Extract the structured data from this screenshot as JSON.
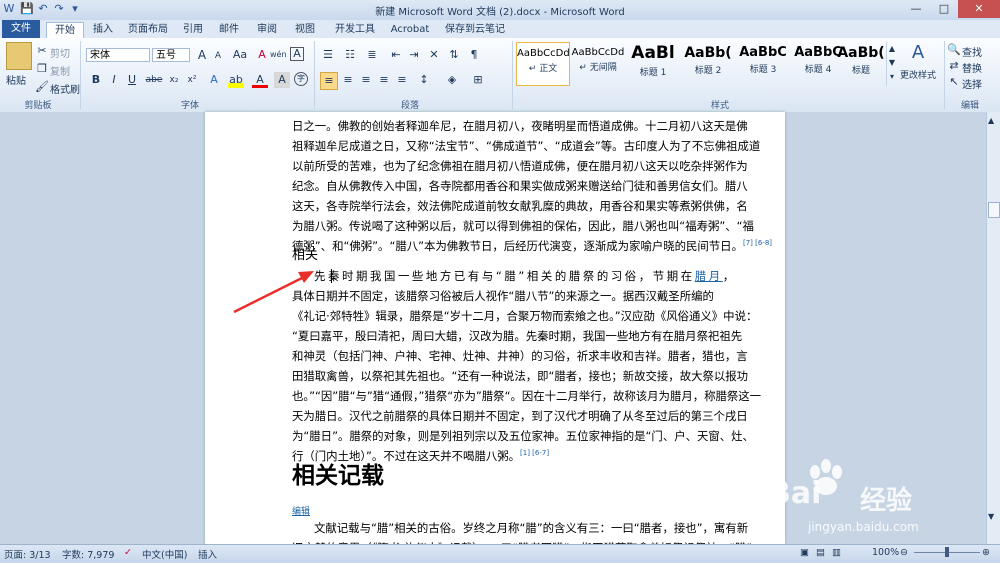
{
  "window": {
    "title": "新建 Microsoft Word 文档 (2).docx - Microsoft Word",
    "min": "—",
    "max": "□",
    "close": "✕"
  },
  "qat": [
    "W",
    "💾",
    "↶",
    "↷",
    "▾"
  ],
  "tabs": [
    "文件",
    "开始",
    "插入",
    "页面布局",
    "引用",
    "邮件",
    "审阅",
    "视图",
    "开发工具",
    "Acrobat",
    "保存到云笔记"
  ],
  "ribbon": {
    "clipboard": {
      "paste": "粘贴",
      "cut": "剪切",
      "copy": "复制",
      "format_painter": "格式刷",
      "label": "剪贴板"
    },
    "font": {
      "name": "宋体",
      "size": "五号",
      "label": "字体",
      "bold": "B",
      "italic": "I",
      "underline": "U",
      "strike": "abe",
      "sub": "x₂",
      "sup": "x²",
      "grow": "A",
      "shrink": "A",
      "case": "Aa",
      "clear": "A",
      "wen": "wén",
      "frame": "A"
    },
    "paragraph": {
      "label": "段落"
    },
    "styles": {
      "label": "样式",
      "items": [
        {
          "preview": "AaBbCcDd",
          "name": "↵ 正文"
        },
        {
          "preview": "AaBbCcDd",
          "name": "↵ 无间隔"
        },
        {
          "preview": "AaBl",
          "name": "标题 1"
        },
        {
          "preview": "AaBb(",
          "name": "标题 2"
        },
        {
          "preview": "AaBbC",
          "name": "标题 3"
        },
        {
          "preview": "AaBbC",
          "name": "标题 4"
        },
        {
          "preview": "AaBb(",
          "name": "标题"
        }
      ],
      "change": "更改样式"
    },
    "editing": {
      "find": "查找",
      "replace": "替换",
      "select": "选择",
      "label": "编辑"
    }
  },
  "doc": {
    "p1": [
      "日之一。佛教的创始者释迦牟尼，在腊月初八，夜睹明星而悟道成佛。十二月初八这天是佛",
      "祖释迦牟尼成道之日，又称“法宝节”、“佛成道节”、“成道会”等。古印度人为了不忘佛祖成道",
      "以前所受的苦难，也为了纪念佛祖在腊月初八悟道成佛，便在腊月初八这天以吃杂拌粥作为",
      "纪念。自从佛教传入中国，各寺院都用香谷和果实做成粥来赠送给门徒和善男信女们。腊八",
      "这天，各寺院举行法会，效法佛陀成道前牧女献乳糜的典故，用香谷和果实等煮粥供佛，名",
      "为腊八粥。传说喝了这种粥以后，就可以得到佛祖的保佑，因此，腊八粥也叫“福寿粥”、“福",
      "德粥”、和“佛粥”。“腊八”本为佛教节日，后经历代演变，逐渐成为家喻户晓的民间节日。"
    ],
    "p1_cite": "[7] [6-8]",
    "h_small": "相关",
    "p2": [
      "先秦时期我国一些地方已有与“腊”相关的腊祭的习俗，节期在",
      "具体日期并不固定，该腊祭习俗被后人视作“腊八节”的来源之一。据西汉戴圣所编的",
      "《礼记·郊特牲》辑录，腊祭是“岁十二月，合聚万物而索飨之也。”汉应劭《风俗通义》中说：",
      "“夏曰嘉平，殷曰清祀，周曰大蜡，汉改为腊。先秦时期，我国一些地方有在腊月祭祀祖先",
      "和神灵（包括门神、户神、宅神、灶神、井神）的习俗，祈求丰收和吉祥。腊者，猎也，言",
      "田猎取禽兽，以祭祀其先祖也。“还有一种说法，即“腊者，接也；新故交接，故大祭以报功",
      "也。”“因”腊“与”猎“通假，”猎祭“亦为”腊祭“。因在十二月举行，故称该月为腊月，称腊祭这一",
      "天为腊日。汉代之前腊祭的具体日期并不固定，到了汉代才明确了从冬至过后的第三个戌日",
      "为“腊日”。腊祭的对象，则是列祖列宗以及五位家神。五位家神指的是“门、户、天窗、灶、",
      "行（门内土地）”。不过在这天并不喝腊八粥。"
    ],
    "p2_link_end": "腊月",
    "p2_cite": "[1] [6-7]",
    "h_big": "相关记载",
    "edit": "编辑",
    "p3": [
      "文献记载与“腊”相关的古俗。岁终之月称“腊”的含义有三：一曰“腊者，接也”，寓有新",
      "旧交替的意思（《隋书·礼仪志》记载）；二曰“腊者同猎”，指田猎获取禽兽好祭祖祭神，“腊”"
    ]
  },
  "status": {
    "page": "页面: 3/13",
    "words": "字数: 7,979",
    "lang": "中文(中国)",
    "insert": "插入",
    "zoom": "100%"
  },
  "watermark": {
    "brand": "Bai",
    "brand2": "经验",
    "url": "jingyan.baidu.com"
  }
}
